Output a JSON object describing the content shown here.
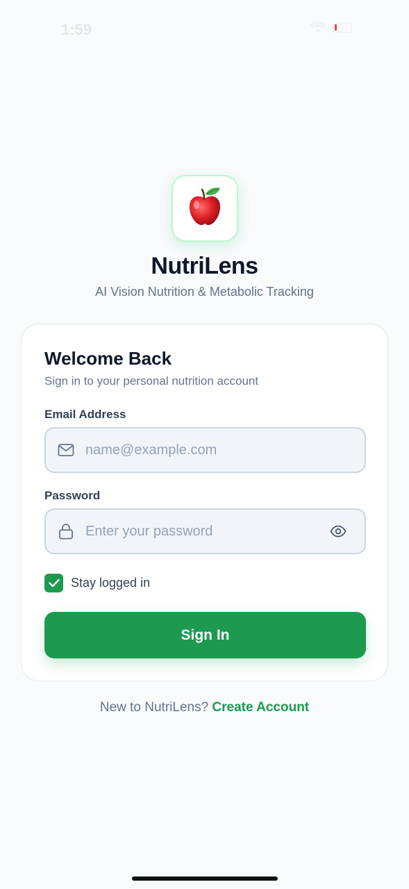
{
  "status_bar": {
    "time": "1:59",
    "icons": [
      "wifi-icon",
      "battery-icon"
    ],
    "battery_color": "#ef4444"
  },
  "brand": {
    "logo_icon": "apple-icon",
    "app_name": "NutriLens",
    "tagline": "AI Vision Nutrition & Metabolic Tracking"
  },
  "login_card": {
    "title": "Welcome Back",
    "subtitle": "Sign in to your personal nutrition account",
    "email": {
      "label": "Email Address",
      "placeholder": "name@example.com",
      "value": "",
      "icon": "mail-icon"
    },
    "password": {
      "label": "Password",
      "placeholder": "Enter your password",
      "value": "",
      "icon": "lock-icon",
      "toggle_icon": "eye-icon"
    },
    "remember": {
      "label": "Stay logged in",
      "checked": true
    },
    "submit_label": "Sign In"
  },
  "footer": {
    "prompt": "New to NutriLens? ",
    "link_label": "Create Account"
  },
  "colors": {
    "accent": "#1d9a50",
    "background": "#f8fafc",
    "text_primary": "#0f172a",
    "text_secondary": "#64748b"
  }
}
